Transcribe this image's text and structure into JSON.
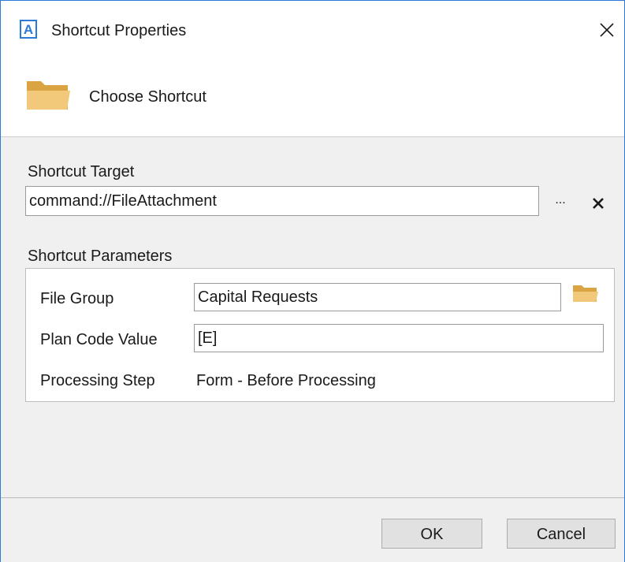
{
  "window": {
    "title": "Shortcut Properties",
    "app_icon_letter": "A",
    "accent_color": "#2b79d8"
  },
  "header": {
    "text": "Choose Shortcut",
    "icon": "folder-icon"
  },
  "shortcut_target": {
    "label": "Shortcut Target",
    "value": "command://FileAttachment",
    "browse_label": "...",
    "clear_icon": "close-icon"
  },
  "shortcut_parameters": {
    "label": "Shortcut Parameters",
    "rows": [
      {
        "label": "File Group",
        "value": "Capital Requests",
        "type": "textbox-with-folder"
      },
      {
        "label": "Plan Code Value",
        "value": "[E]",
        "type": "textbox"
      },
      {
        "label": "Processing Step",
        "value": "Form - Before Processing",
        "type": "static"
      }
    ]
  },
  "buttons": {
    "ok": "OK",
    "cancel": "Cancel"
  }
}
